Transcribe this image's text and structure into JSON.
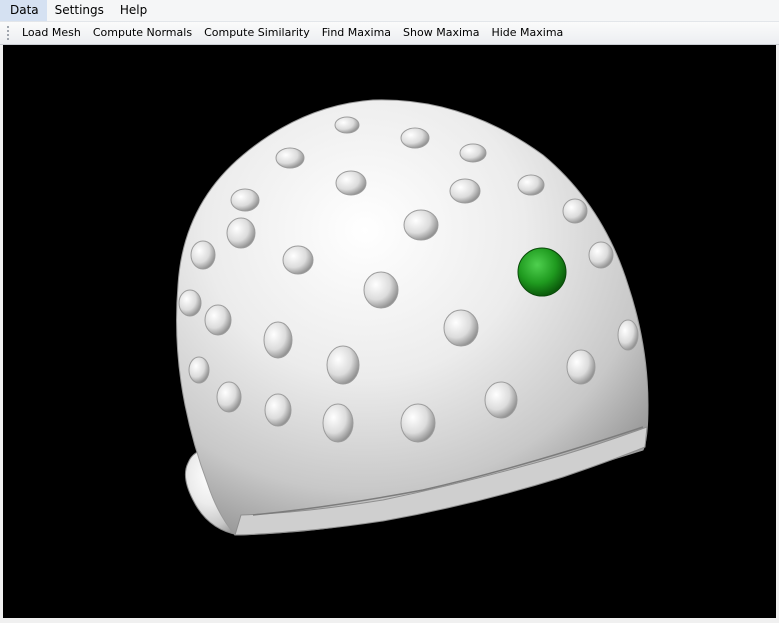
{
  "menubar": {
    "items": [
      {
        "label": "Data"
      },
      {
        "label": "Settings"
      },
      {
        "label": "Help"
      }
    ]
  },
  "toolbar": {
    "buttons": [
      {
        "label": "Load Mesh"
      },
      {
        "label": "Compute Normals"
      },
      {
        "label": "Compute Similarity"
      },
      {
        "label": "Find Maxima"
      },
      {
        "label": "Show Maxima"
      },
      {
        "label": "Hide Maxima"
      }
    ]
  },
  "viewport": {
    "background_color": "#000000",
    "mesh_color": "#e8e8e8",
    "marker_color": "#1f9a1f",
    "mesh_icon": "head-cap-mesh",
    "marker_icon": "green-sphere-marker"
  }
}
